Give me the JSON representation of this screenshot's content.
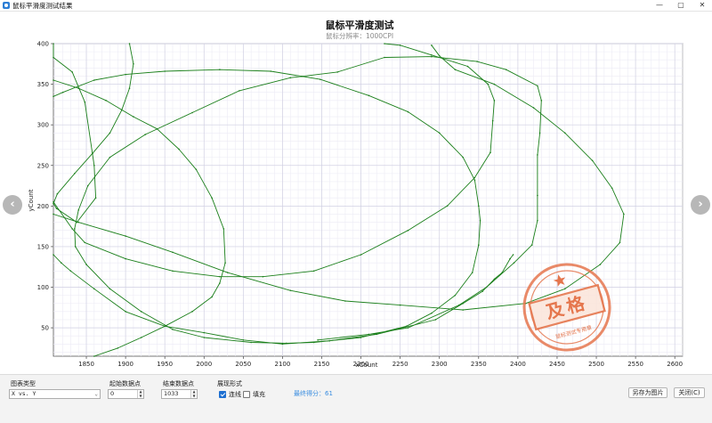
{
  "window": {
    "title": "鼠标平滑度测试结果",
    "controls": {
      "minimize": "—",
      "maximize": "▢",
      "close": "✕"
    }
  },
  "nav": {
    "prev": "‹",
    "next": "›"
  },
  "chart_data": {
    "type": "line",
    "title": "鼠标平滑度测试",
    "subtitle": "鼠标分辨率：1000CPI",
    "xlabel": "xCount",
    "ylabel": "yCount",
    "xlim": [
      1808,
      2610
    ],
    "ylim": [
      15,
      400
    ],
    "xticks": [
      1850,
      1900,
      1950,
      2000,
      2050,
      2100,
      2150,
      2200,
      2250,
      2300,
      2350,
      2400,
      2450,
      2500,
      2550,
      2600
    ],
    "yticks": [
      50,
      100,
      150,
      200,
      250,
      300,
      350,
      400
    ],
    "grid": true,
    "line_color": "#1a7f1a",
    "series": [
      {
        "points": [
          [
            1808,
            400
          ],
          [
            1808,
            383
          ],
          [
            1832,
            365
          ],
          [
            1848,
            328
          ],
          [
            1860,
            250
          ],
          [
            1862,
            210
          ],
          [
            1838,
            180
          ],
          [
            1812,
            197
          ],
          [
            1808,
            203
          ],
          [
            1813,
            215
          ],
          [
            1835,
            240
          ],
          [
            1858,
            265
          ],
          [
            1880,
            290
          ],
          [
            1895,
            318
          ],
          [
            1905,
            345
          ],
          [
            1910,
            375
          ],
          [
            1905,
            400
          ]
        ]
      },
      {
        "points": [
          [
            1808,
            355
          ],
          [
            1840,
            345
          ],
          [
            1875,
            330
          ],
          [
            1910,
            310
          ],
          [
            1940,
            295
          ],
          [
            1968,
            270
          ],
          [
            1990,
            245
          ],
          [
            2010,
            210
          ],
          [
            2025,
            172
          ],
          [
            2027,
            130
          ],
          [
            2020,
            105
          ],
          [
            2010,
            88
          ],
          [
            1985,
            70
          ],
          [
            1950,
            52
          ],
          [
            1920,
            38
          ],
          [
            1890,
            25
          ],
          [
            1860,
            15
          ]
        ]
      },
      {
        "points": [
          [
            1808,
            335
          ],
          [
            1820,
            340
          ],
          [
            1860,
            355
          ],
          [
            1900,
            362
          ],
          [
            1950,
            366
          ],
          [
            2020,
            368
          ],
          [
            2085,
            366
          ],
          [
            2148,
            356
          ],
          [
            2210,
            336
          ],
          [
            2260,
            316
          ],
          [
            2300,
            290
          ],
          [
            2330,
            260
          ],
          [
            2345,
            232
          ],
          [
            2350,
            200
          ],
          [
            2352,
            182
          ],
          [
            2350,
            152
          ],
          [
            2342,
            118
          ],
          [
            2320,
            90
          ],
          [
            2290,
            68
          ],
          [
            2258,
            52
          ],
          [
            2200,
            38
          ],
          [
            2140,
            32
          ],
          [
            2105,
            31
          ],
          [
            2060,
            32
          ],
          [
            2000,
            38
          ],
          [
            1960,
            48
          ],
          [
            1920,
            70
          ],
          [
            1880,
            98
          ],
          [
            1850,
            128
          ],
          [
            1836,
            150
          ],
          [
            1835,
            172
          ],
          [
            1840,
            195
          ],
          [
            1852,
            225
          ],
          [
            1880,
            260
          ],
          [
            1925,
            288
          ],
          [
            1985,
            315
          ],
          [
            2045,
            342
          ],
          [
            2110,
            358
          ],
          [
            2170,
            365
          ],
          [
            2230,
            383
          ],
          [
            2290,
            384
          ],
          [
            2348,
            378
          ],
          [
            2385,
            368
          ],
          [
            2425,
            348
          ],
          [
            2430,
            330
          ],
          [
            2428,
            290
          ],
          [
            2425,
            263
          ],
          [
            2425,
            213
          ],
          [
            2425,
            182
          ],
          [
            2418,
            152
          ],
          [
            2395,
            130
          ],
          [
            2360,
            100
          ],
          [
            2325,
            78
          ],
          [
            2260,
            50
          ],
          [
            2210,
            42
          ],
          [
            2145,
            35
          ]
        ]
      },
      {
        "points": [
          [
            1808,
            140
          ],
          [
            1818,
            130
          ],
          [
            1830,
            120
          ],
          [
            1860,
            98
          ],
          [
            1900,
            70
          ],
          [
            1950,
            52
          ],
          [
            2000,
            44
          ],
          [
            2050,
            35
          ],
          [
            2100,
            30
          ],
          [
            2160,
            34
          ],
          [
            2220,
            42
          ],
          [
            2295,
            60
          ],
          [
            2330,
            80
          ],
          [
            2355,
            95
          ],
          [
            2370,
            110
          ],
          [
            2380,
            118
          ],
          [
            2390,
            135
          ],
          [
            2394,
            140
          ]
        ]
      },
      {
        "points": [
          [
            1808,
            205
          ],
          [
            1832,
            172
          ],
          [
            1848,
            155
          ],
          [
            1900,
            135
          ],
          [
            1960,
            120
          ],
          [
            2020,
            113
          ],
          [
            2075,
            113
          ],
          [
            2140,
            120
          ],
          [
            2200,
            140
          ],
          [
            2260,
            170
          ],
          [
            2310,
            200
          ],
          [
            2345,
            235
          ],
          [
            2365,
            266
          ],
          [
            2368,
            305
          ],
          [
            2370,
            330
          ],
          [
            2362,
            350
          ],
          [
            2336,
            372
          ],
          [
            2290,
            386
          ],
          [
            2250,
            398
          ],
          [
            2230,
            400
          ]
        ]
      },
      {
        "points": [
          [
            1808,
            190
          ],
          [
            1840,
            180
          ],
          [
            1900,
            163
          ],
          [
            1960,
            143
          ],
          [
            2030,
            118
          ],
          [
            2110,
            96
          ],
          [
            2180,
            83
          ],
          [
            2250,
            78
          ],
          [
            2330,
            72
          ],
          [
            2410,
            80
          ],
          [
            2460,
            98
          ],
          [
            2505,
            128
          ],
          [
            2530,
            155
          ],
          [
            2535,
            190
          ],
          [
            2520,
            222
          ],
          [
            2495,
            256
          ],
          [
            2460,
            290
          ],
          [
            2420,
            321
          ],
          [
            2370,
            350
          ],
          [
            2320,
            368
          ],
          [
            2300,
            385
          ],
          [
            2290,
            398
          ]
        ]
      }
    ]
  },
  "stamp": {
    "text": "及格",
    "ring_text": "鼠标测试专用章",
    "color": "#e5764d"
  },
  "controls": {
    "chart_type": {
      "label": "图表类型",
      "value": "X vs. Y"
    },
    "start_point": {
      "label": "起始数据点",
      "value": "0"
    },
    "end_point": {
      "label": "结束数据点",
      "value": "1033"
    },
    "display": {
      "label": "展现形式",
      "connect_label": "连线",
      "connect_checked": true,
      "fill_label": "填充",
      "fill_checked": false
    },
    "score_text": "最终得分：61",
    "save_label": "另存为图片",
    "close_label": "关闭(C)"
  }
}
